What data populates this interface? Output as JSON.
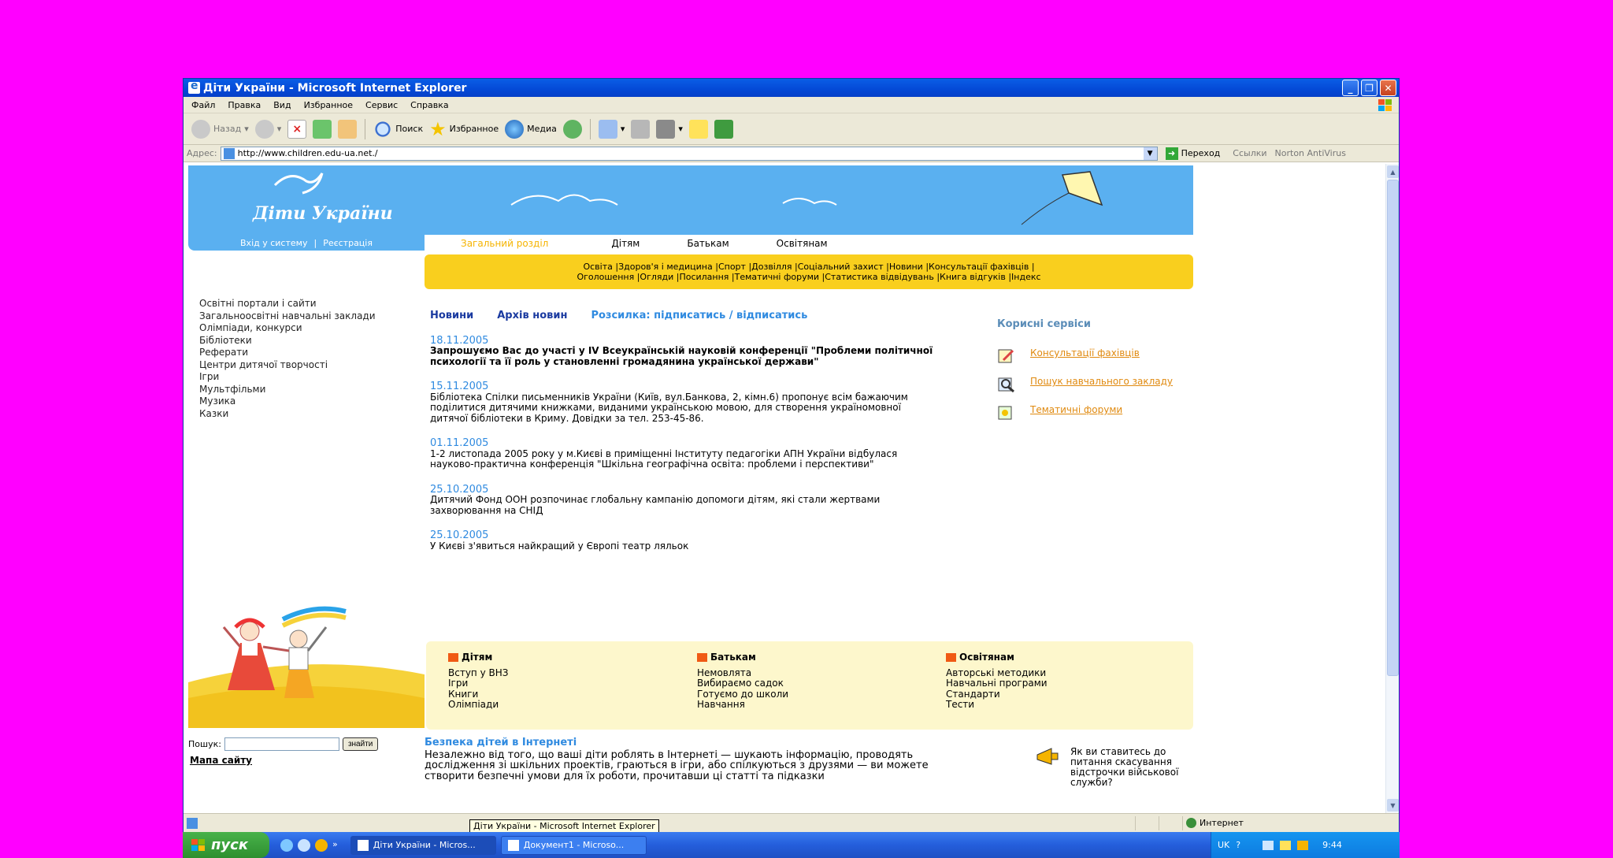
{
  "window": {
    "title": "Діти України - Microsoft Internet Explorer"
  },
  "menu": [
    "Файл",
    "Правка",
    "Вид",
    "Избранное",
    "Сервис",
    "Справка"
  ],
  "toolbar": {
    "back": "Назад",
    "search": "Поиск",
    "favorites": "Избранное",
    "media": "Медиа"
  },
  "address": {
    "label": "Адрес:",
    "url": "http://www.children.edu-ua.net./",
    "go": "Переход",
    "links": "Ссылки",
    "norton": "Norton AntiVirus"
  },
  "site": {
    "logo": "Діти України",
    "login": "Вхід у систему",
    "register": "Реєстрація",
    "tabs": [
      "Загальний розділ",
      "Дітям",
      "Батькам",
      "Освітянам"
    ],
    "nav_row1": [
      "Освіта",
      "Здоров'я і медицина",
      "Спорт",
      "Дозвілля",
      "Соціальний захист",
      "Новини",
      "Консультації фахівців"
    ],
    "nav_row2": [
      "Оголошення",
      "Огляди",
      "Посилання",
      "Тематичні форуми",
      "Статистика відвідувань",
      "Книга відгуків",
      "Індекс"
    ],
    "leftnav": [
      "Освітні портали і сайти",
      "Загальноосвітні навчальні заклади",
      "Олімпіади, конкурси",
      "Бібліотеки",
      "Реферати",
      "Центри дитячої творчості",
      "Ігри",
      "Мультфільми",
      "Музика",
      "Казки"
    ],
    "news_tabs": {
      "news": "Новини",
      "archive": "Архів новин",
      "mailing": "Розсилка: підписатись / відписатись"
    },
    "news": [
      {
        "date": "18.11.2005",
        "text": "Запрошуємо Вас до участі у IV Всеукраїнській науковій конференції \"Проблеми політичної психології та її роль у становленні громадянина української держави\""
      },
      {
        "date": "15.11.2005",
        "text": "Бібліотека Спілки письменників України (Київ, вул.Банкова, 2, кімн.6) пропонує всім бажаючим поділитися дитячими книжками, виданими українською мовою, для створення україномовної дитячої бібліотеки в Криму. Довідки за тел. 253-45-86."
      },
      {
        "date": "01.11.2005",
        "text": "1-2 листопада 2005 року у м.Києві в приміщенні Інституту педагогіки АПН України відбулася науково-практична конференція \"Шкільна географічна освіта: проблеми і перспективи\""
      },
      {
        "date": "25.10.2005",
        "text": "Дитячий Фонд ООН розпочинає глобальну кампанію допомоги дітям, які стали жертвами захворювання на СНІД"
      },
      {
        "date": "25.10.2005",
        "text": "У Києві з'явиться найкращий у Європі театр ляльок"
      }
    ],
    "services_title": "Корисні сервіси",
    "services": [
      "Консультації фахівців",
      "Пошук навчального закладу",
      "Тематичні форуми"
    ],
    "cols": [
      {
        "title": "Дітям",
        "items": [
          "Вступ у ВНЗ",
          "Ігри",
          "Книги",
          "Олімпіади"
        ]
      },
      {
        "title": "Батькам",
        "items": [
          "Немовлята",
          "Вибираємо садок",
          "Готуємо до школи",
          "Навчання"
        ]
      },
      {
        "title": "Освітянам",
        "items": [
          "Авторські методики",
          "Навчальні програми",
          "Стандарти",
          "Тести"
        ]
      }
    ],
    "search_label": "Пошук:",
    "search_btn": "знайти",
    "sitemap": "Мапа сайту",
    "safety_title": "Безпека дітей в Інтернеті",
    "safety_text": "Незалежно від того, що ваші діти роблять в Інтернеті — шукають інформацію, проводять дослідження зі шкільних проектів, граються в ігри, або спілкуються з друзями — ви можете створити безпечні умови для їх роботи, прочитавши ці статті та підказки",
    "poll": "Як ви ставитесь до питання скасування відстрочки військової служби?"
  },
  "statusbar": {
    "zone": "Интернет"
  },
  "taskbar": {
    "start": "пуск",
    "tasks": [
      "Діти України - Micros...",
      "Документ1 - Microso..."
    ],
    "lang": "UK",
    "time": "9:44",
    "tooltip": "Діти України - Microsoft Internet Explorer"
  },
  "colors": {
    "accent_blue": "#5ab0f0",
    "nav_yellow": "#f9cf1e",
    "link_orange": "#e08a10"
  }
}
